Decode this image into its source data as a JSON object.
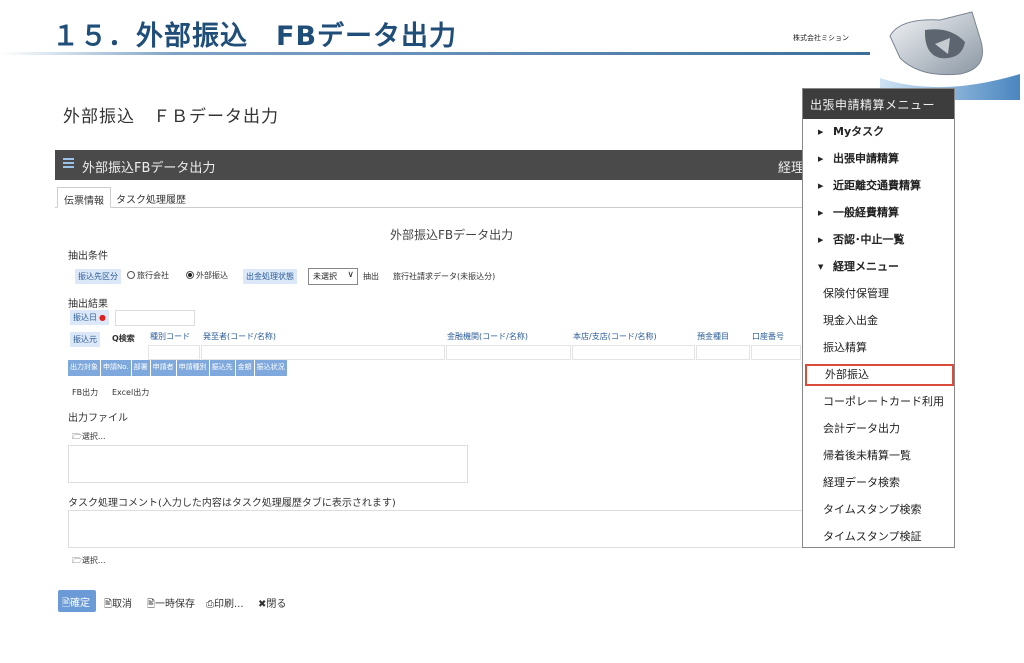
{
  "slide": {
    "title": "１５．外部振込　FBデータ出力",
    "company": "株式会社ミション"
  },
  "page_heading": "外部振込　ＦＢデータ出力",
  "app": {
    "bar_title": "外部振込FBデータ出力",
    "bar_right": "経理",
    "tabs": [
      "伝票情報",
      "タスク処理履歴"
    ],
    "form_title": "外部振込FBデータ出力",
    "extract_conditions_label": "抽出条件",
    "filter": {
      "transfer_type_chip": "振込先区分",
      "radio_travel": "旅行会社",
      "radio_external": "外部振込",
      "status_chip": "出金処理状態",
      "select_value": "未選択",
      "extract_label": "抽出",
      "travel_invoice_label": "旅行社請求データ(未振込分)"
    },
    "extract_results_label": "抽出結果",
    "transfer_date_chip": "振込日",
    "required_mark": "●",
    "columns": {
      "payee": "振込元",
      "search": "Q検索",
      "type_code": "種別コード",
      "applicant": "発至者(コード/名称)",
      "bank": "金融機関(コード/名称)",
      "branch": "本店/支店(コード/名称)",
      "deposit_type": "預金種目",
      "account_no": "口座番号"
    },
    "grid_headers": [
      "出力対象",
      "申請No.",
      "部署",
      "申請者",
      "申請種別",
      "振込先",
      "金額",
      "振込状況"
    ],
    "fb_output": "FB出力",
    "excel_output": "Excel出力",
    "output_file_label": "出力ファイル",
    "select_file_1": "🗁選択...",
    "comment_label": "タスク処理コメント(入力した内容はタスク処理履歴タブに表示されます)",
    "select_file_2": "🗁選択...",
    "actions": {
      "confirm": "🖹確定",
      "cancel": "🖹取消",
      "temp_save": "🖹一時保存",
      "print": "⎙印刷...",
      "close": "✖閉る"
    }
  },
  "side_menu": {
    "header": "出張申請精算メニュー",
    "items": [
      {
        "label": "Myタスク",
        "expandable": true
      },
      {
        "label": "出張申請精算",
        "expandable": true
      },
      {
        "label": "近距離交通費精算",
        "expandable": true
      },
      {
        "label": "一般経費精算",
        "expandable": true
      },
      {
        "label": "否認･中止一覧",
        "expandable": true
      },
      {
        "label": "経理メニュー",
        "expandable": true,
        "expanded": true
      },
      {
        "label": "保険付保管理"
      },
      {
        "label": "現金入出金"
      },
      {
        "label": "振込精算"
      },
      {
        "label": "外部振込",
        "selected": true
      },
      {
        "label": "コーポレートカード利用"
      },
      {
        "label": "会計データ出力"
      },
      {
        "label": "帰着後未精算一覧"
      },
      {
        "label": "経理データ検索"
      },
      {
        "label": "タイムスタンプ検索"
      },
      {
        "label": "タイムスタンプ検証"
      }
    ]
  },
  "colors": {
    "title_blue": "#1f4e79",
    "app_bar": "#4a4a4a",
    "chip_bg": "#dce8f7",
    "grid_header_blue": "#7fa8dc",
    "highlight_red": "#d94c3a"
  }
}
